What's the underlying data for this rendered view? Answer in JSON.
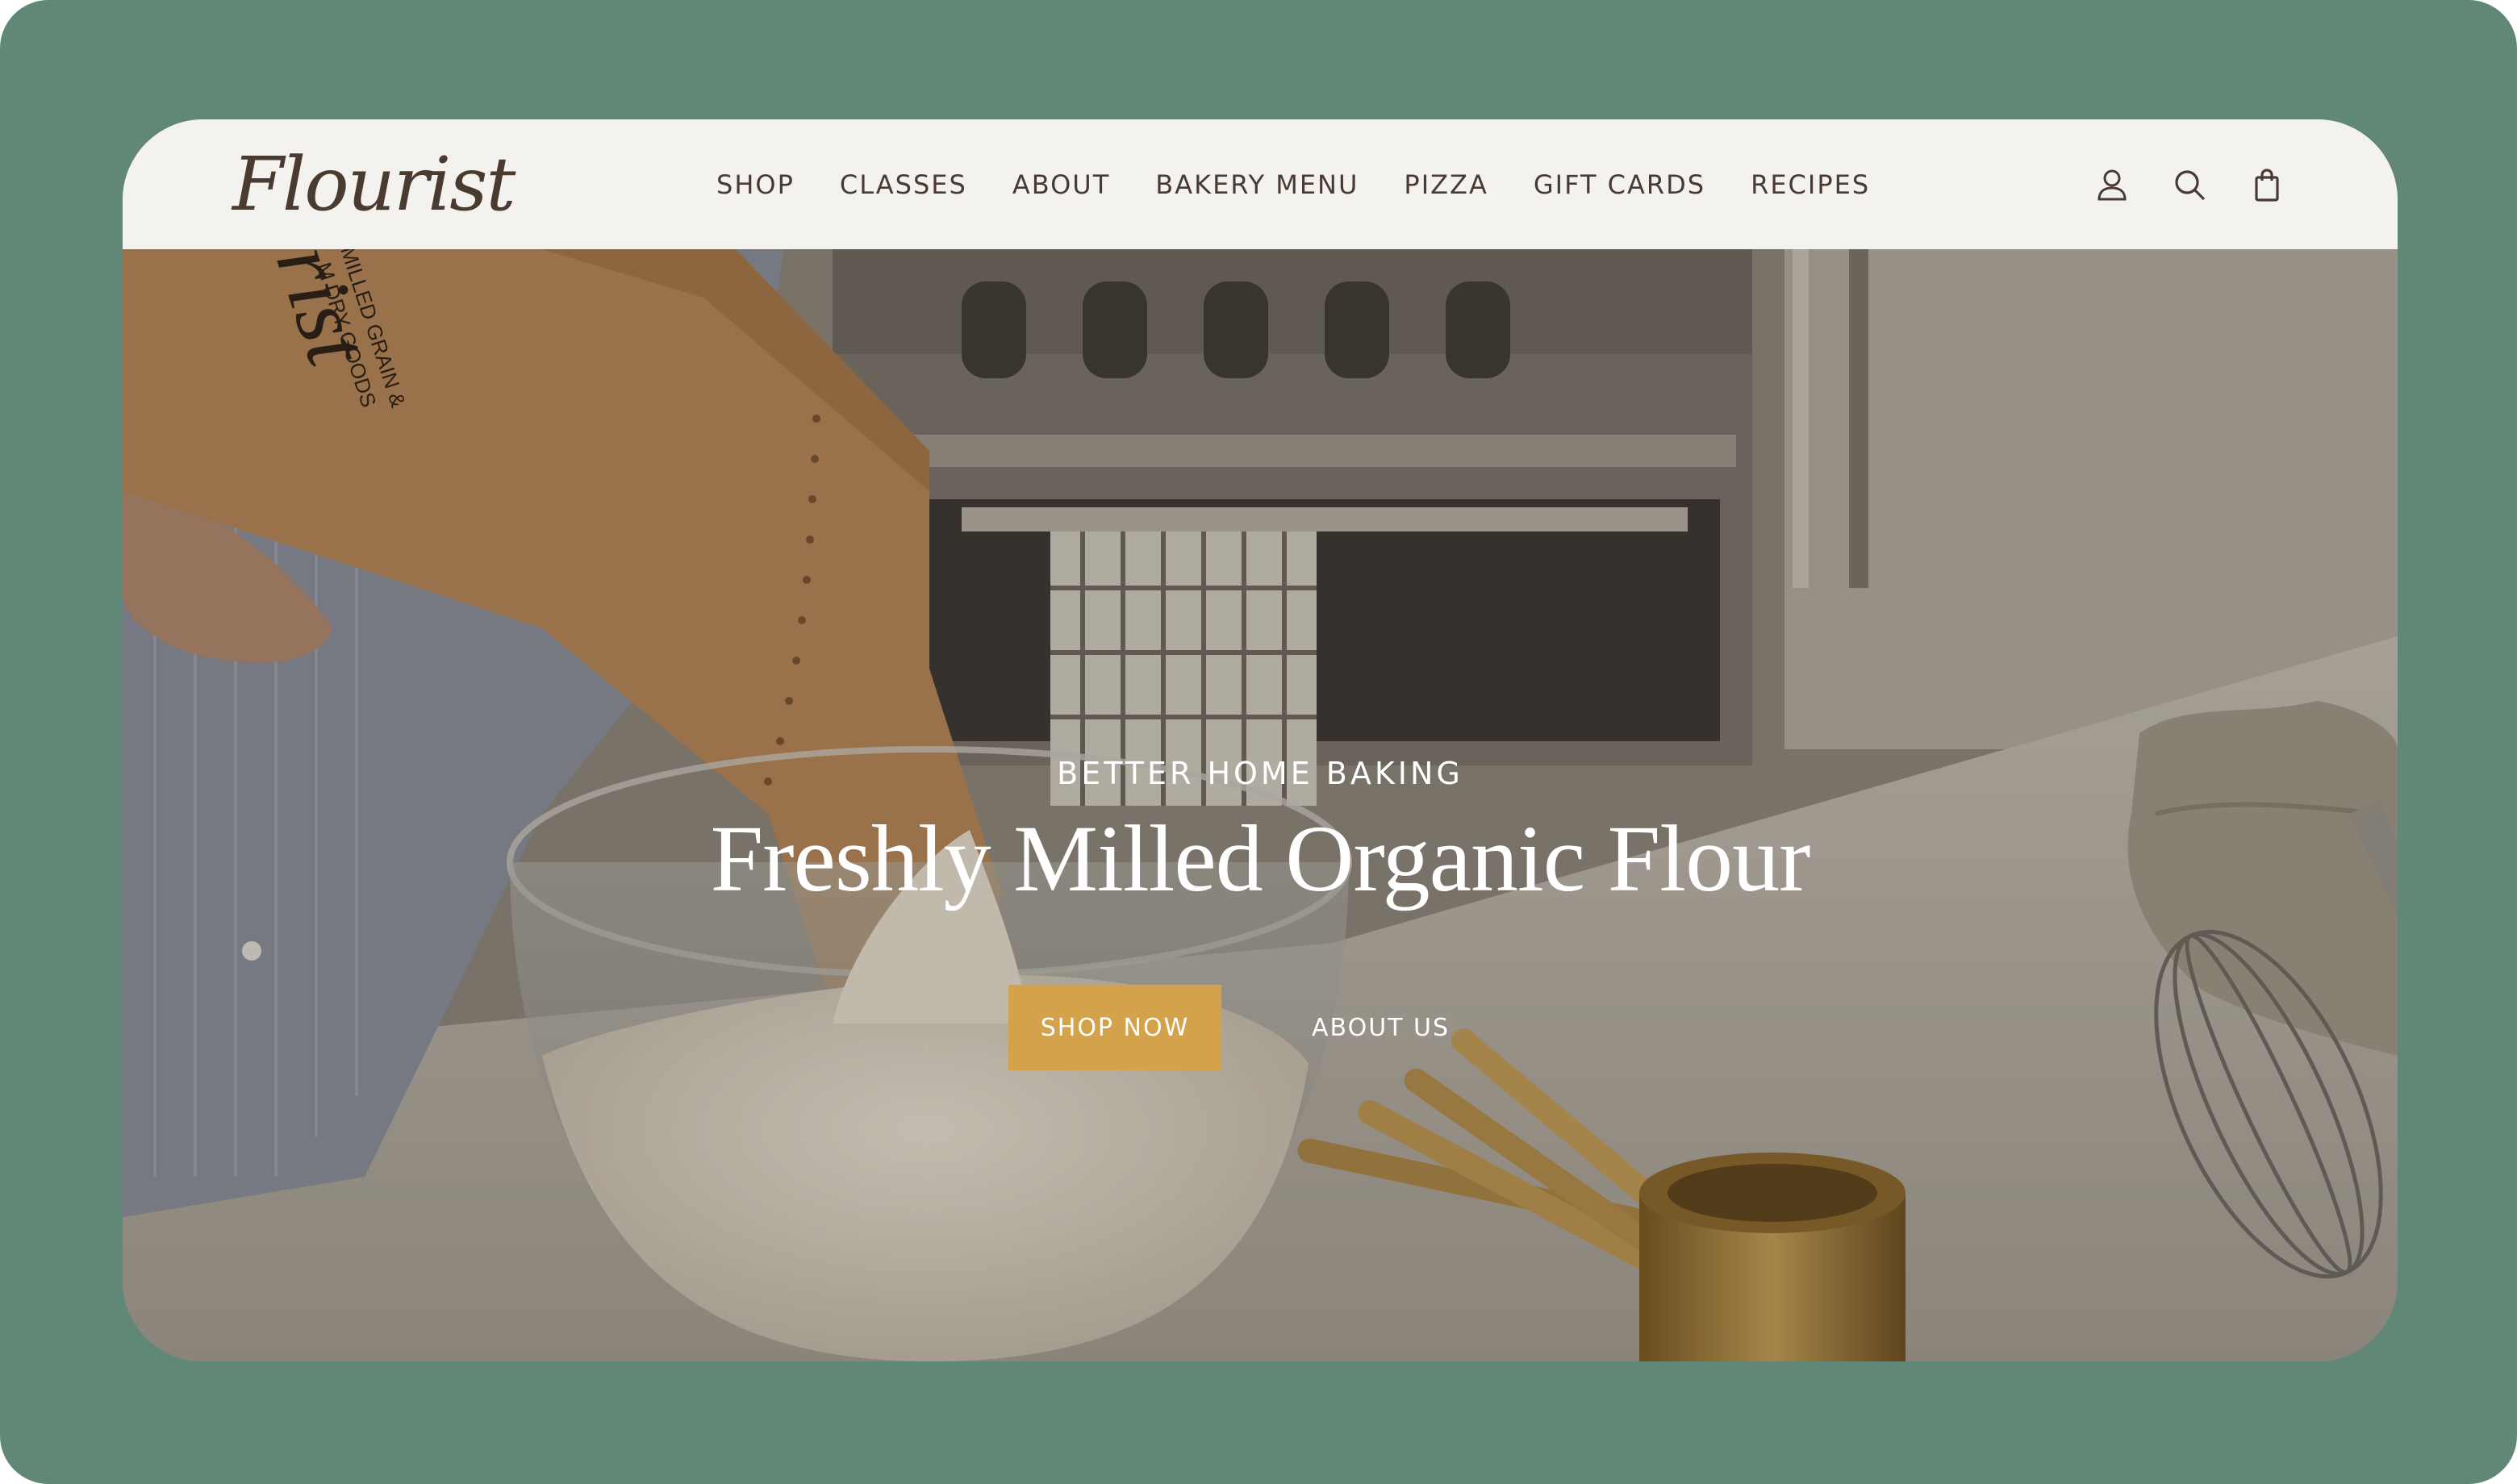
{
  "header": {
    "logo_text": "Flourist",
    "nav": [
      {
        "label": "SHOP"
      },
      {
        "label": "CLASSES"
      },
      {
        "label": "ABOUT"
      },
      {
        "label": "BAKERY MENU"
      },
      {
        "label": "PIZZA"
      },
      {
        "label": "GIFT CARDS"
      },
      {
        "label": "RECIPES"
      }
    ],
    "icons": [
      "account-icon",
      "search-icon",
      "shopping-bag-icon"
    ]
  },
  "hero": {
    "eyebrow": "BETTER HOME BAKING",
    "headline": "Freshly Milled Organic Flour",
    "primary_cta": "SHOP NOW",
    "secondary_cta": "ABOUT US",
    "bag_text_1": "MILLED GRAIN &",
    "bag_text_2": "M DRY GOODS"
  },
  "colors": {
    "frame_bg": "#618877",
    "header_bg": "#f4f2ef",
    "accent": "#d4a24a"
  }
}
